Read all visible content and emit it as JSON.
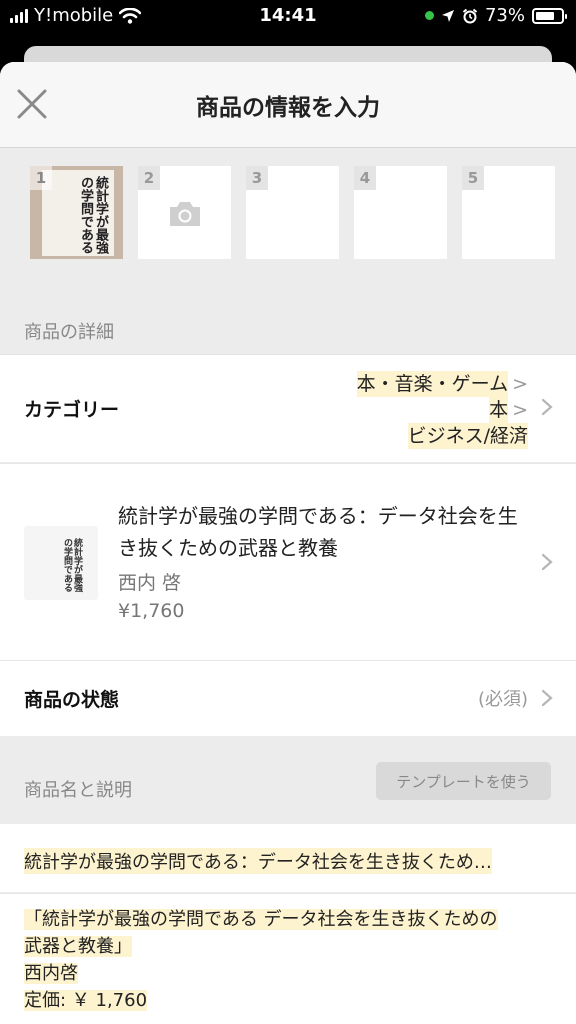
{
  "status_bar": {
    "carrier": "Y!mobile",
    "time": "14:41",
    "battery": "73%",
    "battery_level": 0.73
  },
  "header": {
    "title": "商品の情報を入力"
  },
  "photos": {
    "slots": [
      "1",
      "2",
      "3",
      "4",
      "5"
    ],
    "book_cover_text": "統計学が最強の学問である"
  },
  "details": {
    "section_label": "商品の詳細",
    "category": {
      "label": "カテゴリー",
      "path": [
        "本・音楽・ゲーム",
        "本",
        "ビジネス/経済"
      ],
      "separator": ">"
    },
    "product": {
      "title": "統計学が最強の学問である：データ社会を生き抜くための武器と教養",
      "author": "西内 啓",
      "price": "¥1,760"
    },
    "condition": {
      "label": "商品の状態",
      "hint": "(必須)"
    }
  },
  "name_desc": {
    "section_label": "商品名と説明",
    "template_button": "テンプレートを使う",
    "name_value": "統計学が最強の学問である：データ社会を生き抜くため…",
    "description_lines": [
      "「統計学が最強の学問である データ社会を生き抜くための",
      "武器と教養」",
      "西内啓",
      "定価: ￥ 1,760"
    ]
  },
  "colors": {
    "highlight": "#fdf3cf",
    "section_bg": "#ececec",
    "template_button_bg": "#d9d9d9",
    "status_green": "#37c24a"
  }
}
